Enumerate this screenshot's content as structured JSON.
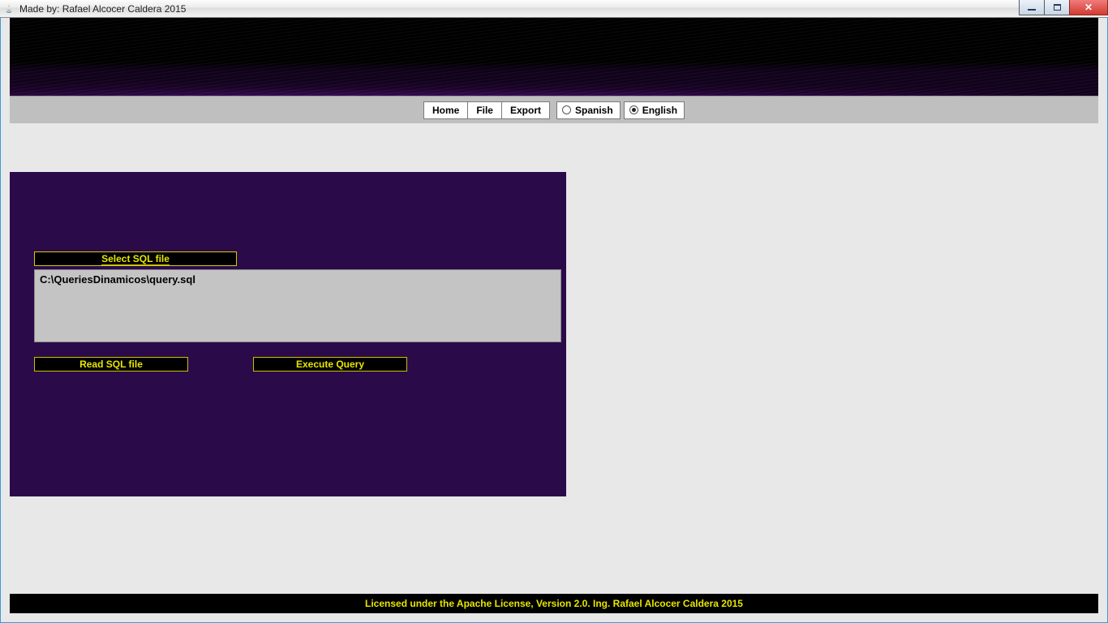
{
  "window": {
    "title": "Made by: Rafael Alcocer Caldera 2015"
  },
  "toolbar": {
    "home": "Home",
    "file": "File",
    "export": "Export",
    "language": {
      "spanish": "Spanish",
      "english": "English",
      "selected": "english"
    }
  },
  "panel": {
    "select_label": "Select SQL file",
    "file_path": "C:\\QueriesDinamicos\\query.sql",
    "read_label": "Read SQL file",
    "execute_label": "Execute Query"
  },
  "footer": {
    "text": "Licensed under the Apache License, Version 2.0. Ing. Rafael Alcocer Caldera 2015"
  }
}
